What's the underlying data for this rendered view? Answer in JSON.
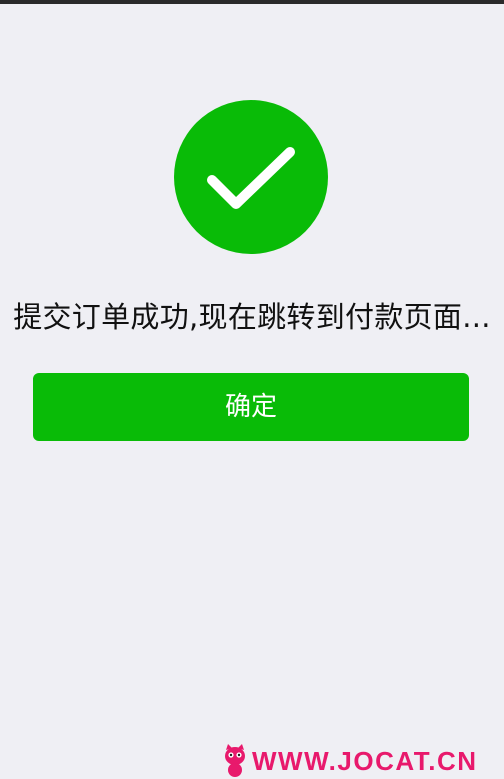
{
  "message": "提交订单成功,现在跳转到付款页面...",
  "confirm_button": {
    "label": "确定"
  },
  "watermark": {
    "text": "WWW.JOCAT.CN"
  },
  "icons": {
    "success": "check-circle-icon",
    "watermark_logo": "cat-logo-icon"
  },
  "colors": {
    "accent_green": "#09bb07",
    "background": "#efeff4",
    "message_text": "#111111",
    "watermark": "#e8196c"
  }
}
